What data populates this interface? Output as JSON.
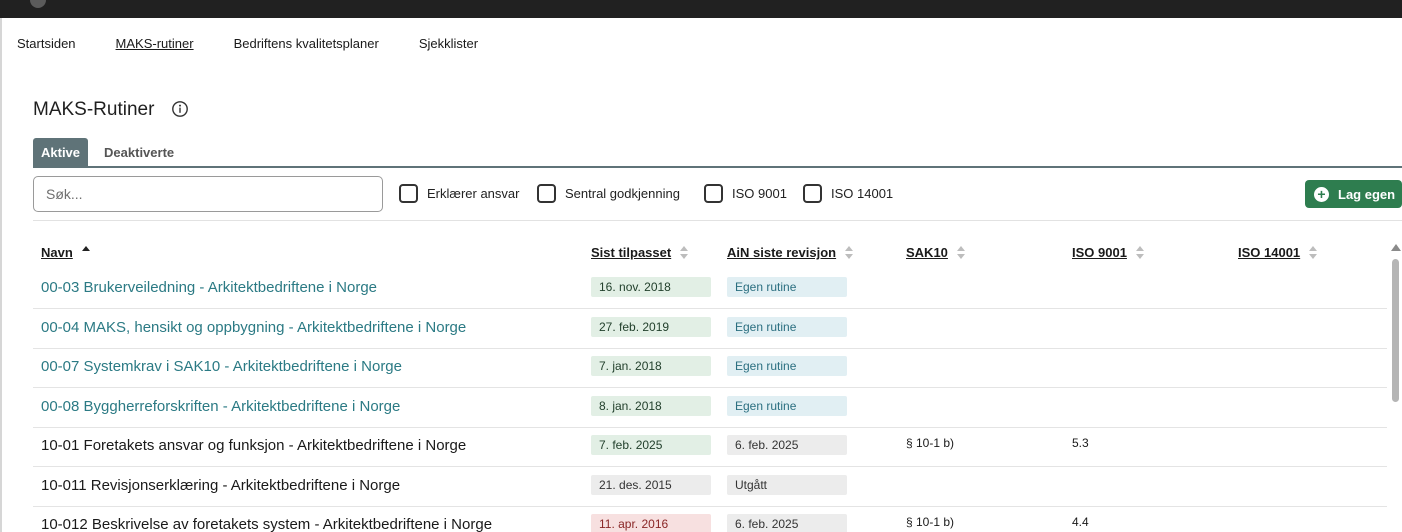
{
  "nav": {
    "items": [
      {
        "label": "Startsiden"
      },
      {
        "label": "MAKS-rutiner"
      },
      {
        "label": "Bedriftens kvalitetsplaner"
      },
      {
        "label": "Sjekklister"
      }
    ],
    "active": "MAKS-rutiner"
  },
  "page": {
    "title": "MAKS-Rutiner",
    "info_icon": "info-circle-icon"
  },
  "tabs": {
    "active": "Aktive",
    "inactive": "Deaktiverte"
  },
  "search": {
    "placeholder": "Søk...",
    "value": ""
  },
  "filters": [
    {
      "label": "Erklærer ansvar",
      "checked": false
    },
    {
      "label": "Sentral godkjenning",
      "checked": false
    },
    {
      "label": "ISO 9001",
      "checked": false
    },
    {
      "label": "ISO 14001",
      "checked": false
    }
  ],
  "add_button": {
    "label": "Lag egen",
    "icon": "plus-circle-icon",
    "color": "#2e7d4f"
  },
  "table": {
    "columns": {
      "name": "Navn",
      "last_adjusted": "Sist tilpasset",
      "ain_revision": "AiN siste revisjon",
      "sak10": "SAK10",
      "iso9001": "ISO 9001",
      "iso14001": "ISO 14001"
    },
    "sorted_by": "name",
    "sort_direction": "ascending",
    "rows": [
      {
        "name": "00-03 Brukerveiledning - Arkitektbedriftene i Norge",
        "last_adjusted": "16. nov. 2018",
        "ain_revision": "Egen rutine",
        "sak10": "",
        "iso9001": "",
        "iso14001": "",
        "link": true,
        "date_status": "ok"
      },
      {
        "name": "00-04 MAKS, hensikt og oppbygning - Arkitektbedriftene i Norge",
        "last_adjusted": "27. feb. 2019",
        "ain_revision": "Egen rutine",
        "sak10": "",
        "iso9001": "",
        "iso14001": "",
        "link": true,
        "date_status": "ok"
      },
      {
        "name": "00-07 Systemkrav i SAK10 - Arkitektbedriftene i Norge",
        "last_adjusted": "7. jan. 2018",
        "ain_revision": "Egen rutine",
        "sak10": "",
        "iso9001": "",
        "iso14001": "",
        "link": true,
        "date_status": "ok"
      },
      {
        "name": "00-08 Byggherreforskriften - Arkitektbedriftene i Norge",
        "last_adjusted": "8. jan. 2018",
        "ain_revision": "Egen rutine",
        "sak10": "",
        "iso9001": "",
        "iso14001": "",
        "link": true,
        "date_status": "ok"
      },
      {
        "name": "10-01 Foretakets ansvar og funksjon - Arkitektbedriftene i Norge",
        "last_adjusted": "7. feb. 2025",
        "ain_revision": "6. feb. 2025",
        "sak10": "§ 10-1 b)",
        "iso9001": "5.3",
        "iso14001": "",
        "link": false,
        "date_status": "ok"
      },
      {
        "name": "10-011 Revisjonserklæring - Arkitektbedriftene i Norge",
        "last_adjusted": "21. des. 2015",
        "ain_revision": "Utgått",
        "sak10": "",
        "iso9001": "",
        "iso14001": "",
        "link": false,
        "date_status": "neutral"
      },
      {
        "name": "10-012 Beskrivelse av foretakets system - Arkitektbedriftene i Norge",
        "last_adjusted": "11. apr. 2016",
        "ain_revision": "6. feb. 2025",
        "sak10": "§ 10-1 b)",
        "iso9001": "4.4",
        "iso14001": "",
        "link": false,
        "date_status": "old"
      }
    ]
  }
}
